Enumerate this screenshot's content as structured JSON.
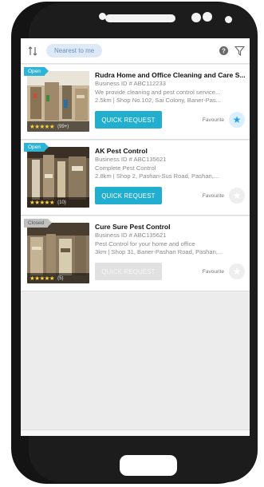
{
  "topbar": {
    "sort_icon": "sort-icon",
    "filter_chip": "Nearest to me",
    "help_icon": "question-circle-icon",
    "filter_icon": "filter-funnel-icon"
  },
  "listings": [
    {
      "status": "Open",
      "title": "Rudra Home and Office Cleaning and Care S...",
      "business_id": "Business ID # ABC112233",
      "description": "We provide cleaning and pest control service...",
      "meta": "2.5km  |  Shop No.102, Sai Colony, Baner-Pas...",
      "rating_stars": "★★★★★",
      "rating_count": "(99+)",
      "button": "QUICK REQUEST",
      "favourite_label": "Favourite",
      "favourite_icon": "star-icon",
      "favourited": true
    },
    {
      "status": "Open",
      "title": "AK Pest Control",
      "business_id": "Business ID # ABC135621",
      "description": "Complete Pest Control",
      "meta": "2.8km  |  Shop 2, Pashan-Sus Road, Pashan,...",
      "rating_stars": "★★★★★",
      "rating_count": "(10)",
      "button": "QUICK REQUEST",
      "favourite_label": "Favourite",
      "favourite_icon": "star-icon",
      "favourited": false
    },
    {
      "status": "Closed",
      "title": "Cure Sure Pest Control",
      "business_id": "Business ID # ABC135621",
      "description": "Pest Control for your home and office",
      "meta": "3km  |  Shop 31, Baner-Pashan Road, Pashan,...",
      "rating_stars": "★★★★★",
      "rating_count": "(5)",
      "button": "QUICK REQUEST",
      "favourite_label": "Favourite",
      "favourite_icon": "star-icon",
      "favourited": false
    }
  ],
  "colors": {
    "accent": "#21aecf",
    "open_badge": "#2eb4d6",
    "closed_badge": "#bfbfbf",
    "chip_bg": "#dde9f7",
    "phone_body": "#141414"
  }
}
